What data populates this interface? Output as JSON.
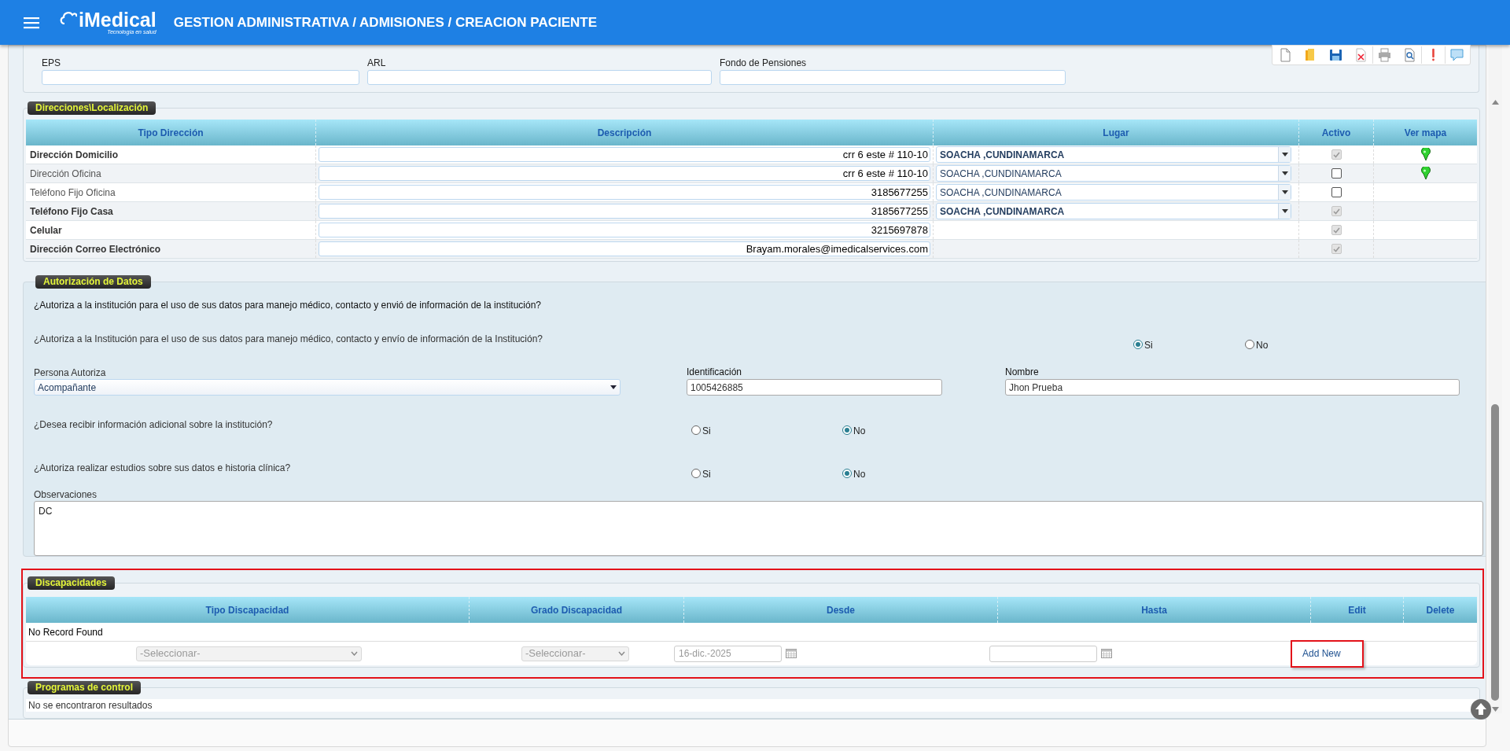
{
  "header": {
    "logo": "iMedical",
    "logo_tagline": "Tecnología en salud",
    "title": "GESTION ADMINISTRATIVA / ADMISIONES / CREACION PACIENTE"
  },
  "insurance": {
    "fields": [
      {
        "label": "EPS"
      },
      {
        "label": "ARL"
      },
      {
        "label": "Fondo de Pensiones"
      }
    ]
  },
  "addresses": {
    "legend": "Direcciones\\Localización",
    "columns": [
      "Tipo Dirección",
      "Descripción",
      "Lugar",
      "Activo",
      "Ver mapa"
    ],
    "rows": [
      {
        "type": "Dirección Domicilio",
        "bold": true,
        "description": "crr 6 este # 110-10",
        "place": "SOACHA ,CUNDINAMARCA",
        "checked": true,
        "disabled": true,
        "map_pin": true
      },
      {
        "type": "Dirección Oficina",
        "bold": false,
        "description": "crr 6 este # 110-10",
        "place": "SOACHA ,CUNDINAMARCA",
        "checked": false,
        "disabled": false,
        "map_pin": true
      },
      {
        "type": "Teléfono Fijo Oficina",
        "bold": false,
        "description": "3185677255",
        "place": "SOACHA ,CUNDINAMARCA",
        "checked": false,
        "disabled": false,
        "map_pin": false
      },
      {
        "type": "Teléfono Fijo Casa",
        "bold": true,
        "description": "3185677255",
        "place": "SOACHA ,CUNDINAMARCA",
        "checked": true,
        "disabled": true,
        "map_pin": false
      },
      {
        "type": "Celular",
        "bold": true,
        "description": "3215697878",
        "checked": true,
        "disabled": true,
        "map_pin": false
      },
      {
        "type": "Dirección Correo Electrónico",
        "bold": true,
        "description": "Brayam.morales@imedicalservices.com",
        "checked": true,
        "disabled": true,
        "map_pin": false
      }
    ]
  },
  "authorization": {
    "legend": "Autorización de Datos",
    "heading": "¿Autoriza a la institución para el uso de sus datos para manejo médico, contacto y envió de información de la institución?",
    "consent": {
      "question": "¿Autoriza a la Institución para el uso de sus datos para manejo médico, contacto y envío de información de la Institución?",
      "options": [
        {
          "label": "Si",
          "selected": true
        },
        {
          "label": "No",
          "selected": false
        }
      ]
    },
    "person": {
      "label": "Persona Autoriza",
      "value": "Acompañante"
    },
    "identification": {
      "label": "Identificación",
      "value": "1005426885"
    },
    "name": {
      "label": "Nombre",
      "value": "Jhon Prueba"
    },
    "questions": [
      {
        "question": "¿Desea recibir información adicional sobre la institución?",
        "options": [
          {
            "label": "Si",
            "selected": false
          },
          {
            "label": "No",
            "selected": true
          }
        ]
      },
      {
        "question": "¿Autoriza realizar estudios sobre sus datos e historia clínica?",
        "options": [
          {
            "label": "Si",
            "selected": false
          },
          {
            "label": "No",
            "selected": true
          }
        ]
      }
    ],
    "notes": {
      "label": "Observaciones",
      "value": "DC"
    }
  },
  "disabilities": {
    "legend": "Discapacidades",
    "highlighted": true,
    "columns": [
      "Tipo Discapacidad",
      "Grado Discapacidad",
      "Desde",
      "Hasta",
      "Edit",
      "Delete"
    ],
    "empty_text": "No Record Found",
    "new_row": {
      "type_placeholder": "-Seleccionar-",
      "grade_placeholder": "-Seleccionar-",
      "from": "16-dic.-2025"
    },
    "add_button": {
      "label": "Add New",
      "highlighted": true
    }
  },
  "programs": {
    "legend": "Programas de control",
    "empty_text": "No se encontraron resultados"
  }
}
